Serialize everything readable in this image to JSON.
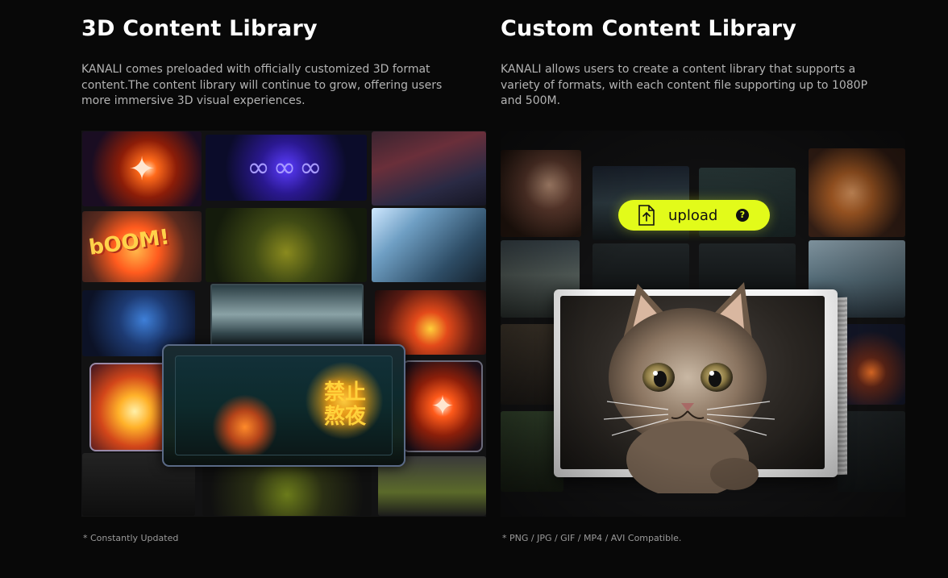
{
  "left": {
    "title": "3D Content Library",
    "description": "KANALI comes preloaded with officially customized 3D format content.The content library will continue to grow, offering users more immersive 3D visual experiences.",
    "note": "* Constantly Updated",
    "center_sign": "禁止熬夜",
    "boom_text": "bOOM!"
  },
  "right": {
    "title": "Custom Content Library",
    "description": "KANALI allows users to create a content library that supports a variety of formats, with each content file supporting up to 1080P and 500M.",
    "note": "* PNG / JPG / GIF / MP4 / AVI Compatible.",
    "upload": {
      "label": "upload",
      "help": "?",
      "icon": "file-upload-icon",
      "accent": "#e2fb1a"
    }
  }
}
